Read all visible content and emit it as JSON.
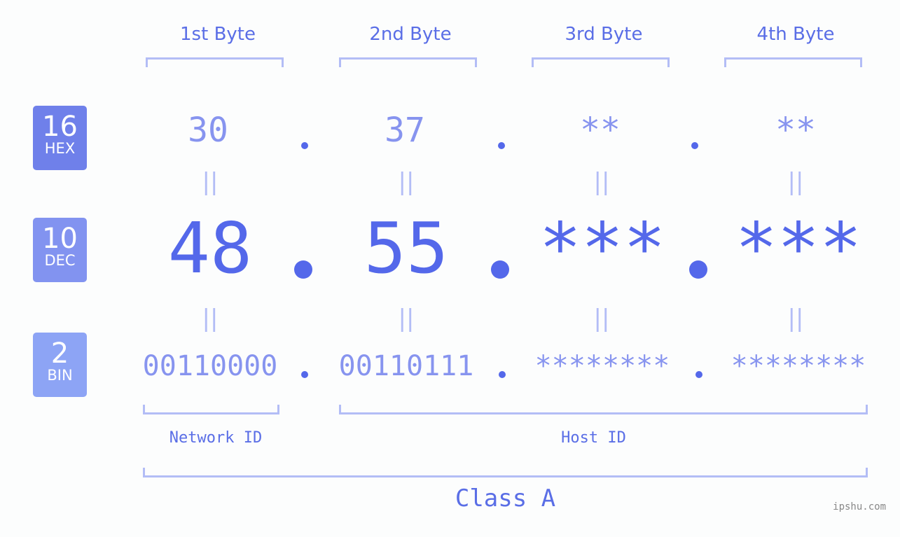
{
  "badges": [
    {
      "num": "16",
      "label": "HEX",
      "color": "#6f80ea"
    },
    {
      "num": "10",
      "label": "DEC",
      "color": "#8293f0"
    },
    {
      "num": "2",
      "label": "BIN",
      "color": "#8da4f5"
    }
  ],
  "byte_headers": [
    "1st Byte",
    "2nd Byte",
    "3rd Byte",
    "4th Byte"
  ],
  "hex": [
    "30",
    "37",
    "**",
    "**"
  ],
  "dec": [
    "48",
    "55",
    "***",
    "***"
  ],
  "bin": [
    "00110000",
    "00110111",
    "********",
    "********"
  ],
  "equals_glyph": "||",
  "network_id_label": "Network ID",
  "host_id_label": "Host ID",
  "class_label": "Class A",
  "watermark": "ipshu.com",
  "colors": {
    "accent": "#5468ea",
    "light": "#8794ef",
    "bracket": "#b3bdf6"
  }
}
